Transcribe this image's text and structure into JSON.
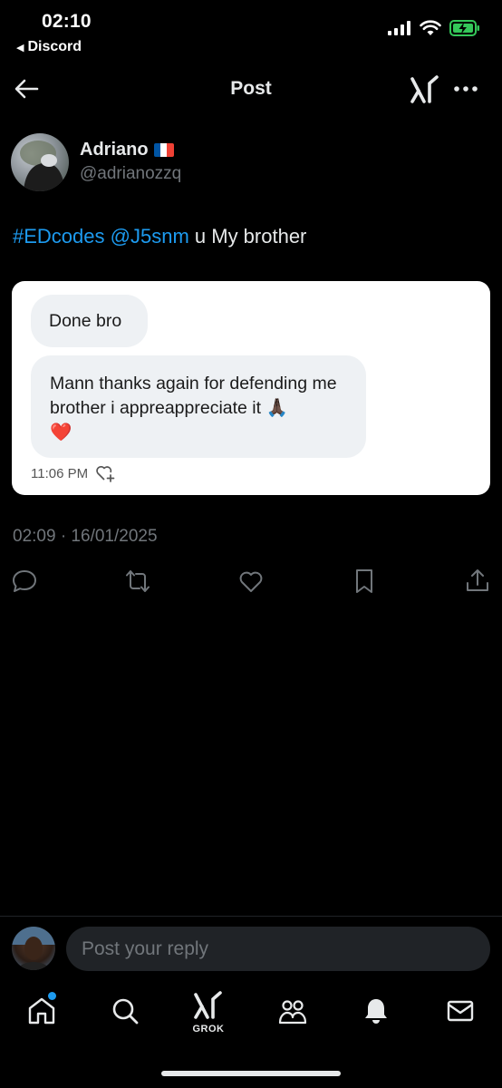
{
  "status_bar": {
    "time": "02:10",
    "back_app": "Discord",
    "icons": [
      "signal-icon",
      "wifi-icon",
      "battery-charging-icon"
    ]
  },
  "header": {
    "title": "Post",
    "icons": [
      "back-arrow-icon",
      "grok-icon",
      "more-icon"
    ]
  },
  "post": {
    "author_name": "Adriano",
    "author_flag": "🇫🇷",
    "author_handle": "@adrianozzq",
    "text_hashtag": "#EDcodes",
    "text_mention": "@J5snm",
    "text_rest": " u My brother",
    "timestamp": "02:09 · 16/01/2025",
    "embedded_image": {
      "message1": "Done bro",
      "message2": "Mann thanks again for defending me brother i appreappreciate it 🙏🏿",
      "message2_heart": "❤️",
      "time": "11:06 PM"
    },
    "actions": [
      "reply-icon",
      "repost-icon",
      "like-icon",
      "bookmark-icon",
      "share-icon"
    ]
  },
  "reply": {
    "placeholder": "Post your reply"
  },
  "nav": {
    "items": [
      "home-icon",
      "search-icon",
      "grok-icon",
      "communities-icon",
      "notifications-icon",
      "messages-icon"
    ],
    "grok_label": "GROK"
  },
  "colors": {
    "background": "#000000",
    "text": "#e7e9ea",
    "muted": "#71767b",
    "accent": "#1d9bf0",
    "battery": "#34c759"
  }
}
